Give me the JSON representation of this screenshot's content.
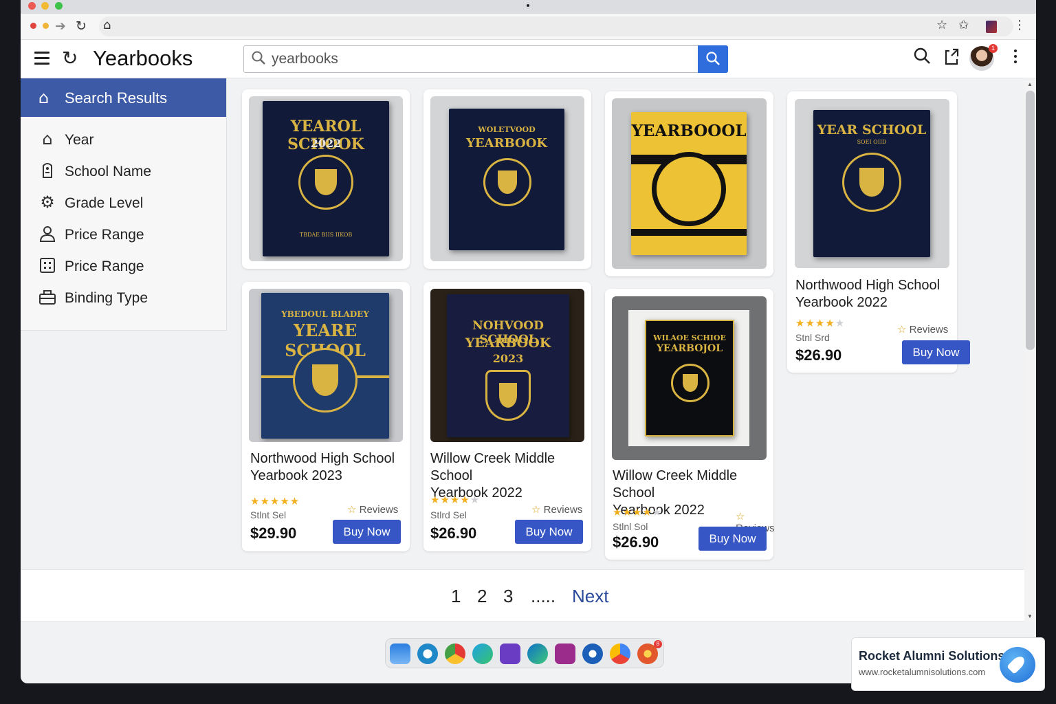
{
  "app": {
    "title": "Yearbooks"
  },
  "search": {
    "value": "yearbooks"
  },
  "sidebar": {
    "header": "Search Results",
    "items": [
      {
        "label": "Year",
        "icon": "home-outline-icon"
      },
      {
        "label": "School Name",
        "icon": "id-tag-icon"
      },
      {
        "label": "Grade Level",
        "icon": "gear-icon"
      },
      {
        "label": "Price Range",
        "icon": "person-icon"
      },
      {
        "label": "Price Range",
        "icon": "grid-icon"
      },
      {
        "label": "Binding Type",
        "icon": "briefcase-icon"
      }
    ]
  },
  "covers": [
    {
      "line1": "YEAROL SCHOOK",
      "line2": "2022",
      "line3": "TBDAE BIIS IIKOB"
    },
    {
      "line1": "WOLETVOOD",
      "line2": "YEARBOOK",
      "line3": ""
    },
    {
      "line1": "YEARBOOOL",
      "line2": "",
      "line3": ""
    },
    {
      "line1": "YEAR SCHOOL",
      "line2": "SOEI OIID",
      "line3": ""
    },
    {
      "line1": "YBEDOUL BLADEY",
      "line2": "YEARE SCHOOL",
      "line3": ""
    },
    {
      "line1": "NOHVOOD SCHOOL",
      "line2": "YEARBOOK",
      "line3": "2023"
    },
    {
      "line1": "WILAOE SCHIOE",
      "line2": "YEARBOJOL",
      "line3": ""
    }
  ],
  "products": [
    {
      "title1": "Northwood High School",
      "title2": "Yearbook 2022",
      "rating": 4,
      "reviews": "Reviews",
      "seller": "Stnl Srd",
      "price": "$26.90",
      "cta": "Buy Now"
    },
    {
      "title1": "Northwood High School",
      "title2": "Yearbook 2023",
      "rating": 5,
      "reviews": "Reviews",
      "seller": "Stlnt Sel",
      "price": "$29.90",
      "cta": "Buy Now"
    },
    {
      "title1": "Willow Creek Middle School",
      "title2": "Yearbook 2022",
      "rating": 4,
      "reviews": "Reviews",
      "seller": "Stlrd Sel",
      "price": "$26.90",
      "cta": "Buy Now"
    },
    {
      "title1": "Willow Creek Middle School",
      "title2": "Yearbook 2022",
      "rating": 4,
      "reviews": "Reviews",
      "seller": "Stlnl Sol",
      "price": "$26.90",
      "cta": "Buy Now"
    }
  ],
  "pagination": {
    "pages": [
      "1",
      "2",
      "3"
    ],
    "ellipsis": ".....",
    "next": "Next"
  },
  "promo": {
    "title": "Rocket Alumni Solutions",
    "url": "www.rocketalumnisolutions.com"
  },
  "badges": {
    "avatar": "1",
    "dock": "8"
  },
  "colors": {
    "accent": "#3d5aa6",
    "button": "#3556c4",
    "search_button": "#2e6ddb",
    "star": "#f2b01e",
    "cover_navy": "#111a38",
    "cover_gold": "#d9b443"
  }
}
